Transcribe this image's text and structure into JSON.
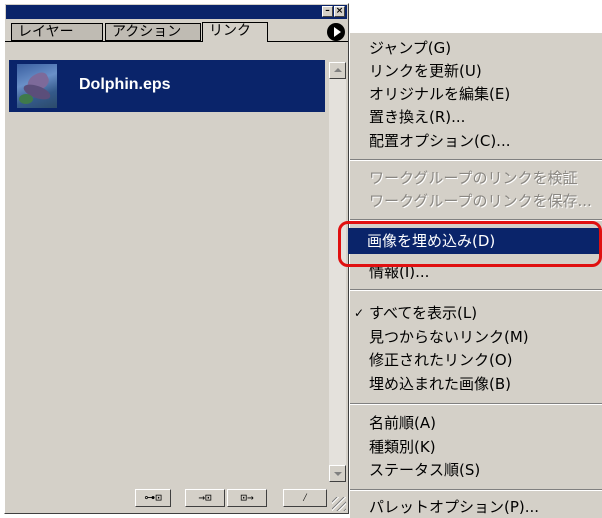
{
  "panel": {
    "tabs": [
      "レイヤー",
      "アクション",
      "リンク"
    ],
    "active_tab": "リンク",
    "items": [
      {
        "name": "Dolphin.eps",
        "selected": true
      }
    ],
    "bottom_buttons": [
      {
        "icon": "relink-icon",
        "glyph": "⊶⊡"
      },
      {
        "icon": "go-to-link-icon",
        "glyph": "→⊡"
      },
      {
        "icon": "update-link-icon",
        "glyph": "⊡→"
      },
      {
        "icon": "edit-original-icon",
        "glyph": "⁄"
      }
    ]
  },
  "menu": {
    "items": [
      {
        "label": "ジャンプ(G)",
        "enabled": true
      },
      {
        "label": "リンクを更新(U)",
        "enabled": true
      },
      {
        "label": "オリジナルを編集(E)",
        "enabled": true
      },
      {
        "label": "置き換え(R)...",
        "enabled": true
      },
      {
        "label": "配置オプション(C)...",
        "enabled": true
      },
      {
        "label": "ワークグループのリンクを検証",
        "enabled": false
      },
      {
        "label": "ワークグループのリンクを保存...",
        "enabled": false
      },
      {
        "label": "画像を埋め込み(D)",
        "enabled": true,
        "highlighted": true
      },
      {
        "label": "情報(I)...",
        "enabled": true
      },
      {
        "label": "すべてを表示(L)",
        "enabled": true,
        "checked": true
      },
      {
        "label": "見つからないリンク(M)",
        "enabled": true
      },
      {
        "label": "修正されたリンク(O)",
        "enabled": true
      },
      {
        "label": "埋め込まれた画像(B)",
        "enabled": true
      },
      {
        "label": "名前順(A)",
        "enabled": true
      },
      {
        "label": "種類別(K)",
        "enabled": true
      },
      {
        "label": "ステータス順(S)",
        "enabled": true
      },
      {
        "label": "パレットオプション(P)...",
        "enabled": true
      }
    ],
    "check_glyph": "✓"
  },
  "colors": {
    "selection": "#0a246a",
    "face": "#d4d0c8",
    "annotation": "#e01010"
  }
}
